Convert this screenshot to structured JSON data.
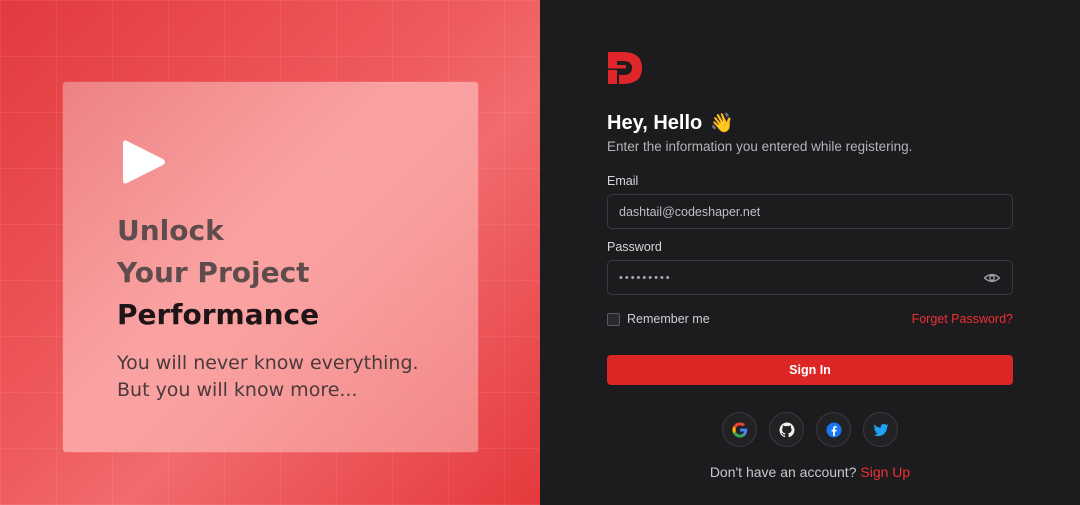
{
  "hero": {
    "heading_line1": "Unlock",
    "heading_line2": "Your Project",
    "heading_line3": "Performance",
    "subtext_line1": "You will never know everything.",
    "subtext_line2": "But you will know more..."
  },
  "auth": {
    "greeting": "Hey, Hello",
    "greeting_emoji": "👋",
    "subtitle": "Enter the information you entered while registering.",
    "email_label": "Email",
    "email_value": "dashtail@codeshaper.net",
    "password_label": "Password",
    "password_value": "password1",
    "remember_label": "Remember me",
    "remember_checked": false,
    "forgot_label": "Forget Password?",
    "signin_label": "Sign In",
    "no_account_text": "Don't have an account?",
    "signup_label": "Sign Up"
  },
  "socials": {
    "google": "google-icon",
    "github": "github-icon",
    "facebook": "facebook-icon",
    "twitter": "twitter-icon"
  },
  "colors": {
    "accent": "#dc2626",
    "link": "#ee2f33",
    "panel_bg": "#1c1c1e",
    "hero_bg": "#e23a3e"
  }
}
